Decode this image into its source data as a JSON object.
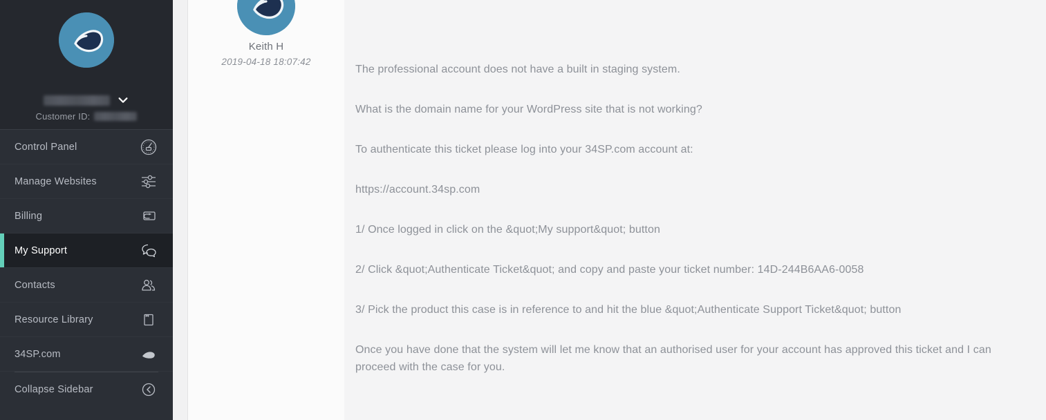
{
  "sidebar": {
    "logo_icon": "teardrop-logo-icon",
    "account_name_redacted": true,
    "account_chevron_icon": "chevron-down-icon",
    "customer_id_label": "Customer ID:",
    "customer_id_value_redacted": true,
    "items": [
      {
        "label": "Control Panel",
        "icon": "gauge-icon",
        "active": false
      },
      {
        "label": "Manage Websites",
        "icon": "sliders-icon",
        "active": false
      },
      {
        "label": "Billing",
        "icon": "credit-card-icon",
        "active": false
      },
      {
        "label": "My Support",
        "icon": "chat-bubbles-icon",
        "active": true
      },
      {
        "label": "Contacts",
        "icon": "people-icon",
        "active": false
      },
      {
        "label": "Resource Library",
        "icon": "book-icon",
        "active": false
      },
      {
        "label": "34SP.com",
        "icon": "teardrop-icon",
        "active": false
      }
    ],
    "collapse": {
      "label": "Collapse Sidebar",
      "icon": "collapse-left-circle-icon"
    }
  },
  "message": {
    "avatar_icon": "teardrop-avatar-icon",
    "author": "Keith H",
    "timestamp": "2019-04-18 18:07:42",
    "paragraphs": [
      "The professional account does not have a built in staging system.",
      "What is the domain name for your WordPress site that is not working?",
      "",
      "To authenticate this ticket please log into your 34SP.com account at:",
      "https://account.34sp.com",
      "1/ Once logged in click on the &quot;My support&quot; button",
      "2/ Click &quot;Authenticate Ticket&quot; and copy and paste your ticket number: 14D-244B6AA6-0058",
      "3/ Pick the product this case is in reference to and hit the blue &quot;Authenticate Support Ticket&quot; button",
      "Once you have done that the system will let me know that an authorised user for your account has approved this ticket and I can proceed with the case for you."
    ]
  },
  "colors": {
    "sidebar_bg": "#2b2f36",
    "sidebar_header_bg": "#25282e",
    "active_bg": "#1d2025",
    "accent_teal": "#63cfb9",
    "avatar_blue": "#4a90b5",
    "avatar_navy": "#1d3050",
    "content_bg": "#f4f4f5",
    "body_text": "#8d9198"
  }
}
